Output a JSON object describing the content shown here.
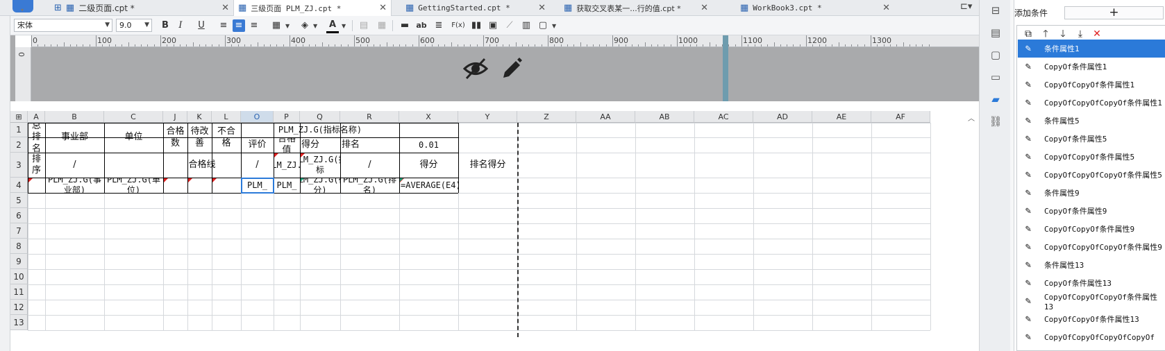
{
  "tabs": [
    {
      "label": "二级页面.cpt *",
      "active": false
    },
    {
      "label": "三级页面  PLM_ZJ.cpt *",
      "active": true
    },
    {
      "label": "GettingStarted.cpt *",
      "active": false
    },
    {
      "label": "获取交叉表某一...行的值.cpt *",
      "active": false
    },
    {
      "label": "WorkBook3.cpt *",
      "active": false
    }
  ],
  "toolbar": {
    "font_name": "宋体",
    "font_size": "9.0",
    "bold": "B",
    "italic": "I",
    "underline": "U",
    "text_glyph": "ab",
    "formula_glyph": "F(x)"
  },
  "ruler": [
    "0",
    "100",
    "200",
    "300",
    "400",
    "500",
    "600",
    "700",
    "800",
    "900",
    "1000",
    "1100",
    "1200",
    "1300"
  ],
  "vruler_zero": "0",
  "columns": [
    "A",
    "B",
    "C",
    "J",
    "K",
    "L",
    "O",
    "P",
    "Q",
    "R",
    "X",
    "Y",
    "Z",
    "AA",
    "AB",
    "AC",
    "AD",
    "AE",
    "AF"
  ],
  "rows": [
    "1",
    "2",
    "3",
    "4",
    "5",
    "6",
    "7",
    "8",
    "9",
    "10",
    "11",
    "12",
    "13"
  ],
  "cells": {
    "a12": "总排名",
    "b12": "事业部",
    "c12": "单位",
    "j12": "合格数",
    "k12": "待改善",
    "l12": "不合格",
    "o1r1": "PLM_ZJ.G(指标名称)",
    "o2": "评价",
    "p2": "合格值",
    "q2": "得分",
    "r2": "排名",
    "x2": "0.01",
    "a3": "排序",
    "b3": "/",
    "jl3": "合格线",
    "o3": "/",
    "p3": "PLM_ZJ.G",
    "q3": "PLM_ZJ.G(指标",
    "r3": "/",
    "x3": "得分",
    "y3": "排名得分",
    "b4": "PLM_ZJ.G(事业部)",
    "c4": "PLM_ZJ.G(单位)",
    "o4": "PLM_",
    "p4": "PLM_",
    "q4": "PLM_ZJ.G(得分)",
    "r4": "PLM_ZJ.G(排名)",
    "x4": "=AVERAGE(E4)"
  },
  "panel": {
    "add_label": "添加条件",
    "add_button": "+",
    "conditions": [
      "条件属性1",
      "CopyOf条件属性1",
      "CopyOfCopyOf条件属性1",
      "CopyOfCopyOfCopyOf条件属性1",
      "条件属性5",
      "CopyOf条件属性5",
      "CopyOfCopyOf条件属性5",
      "CopyOfCopyOfCopyOf条件属性5",
      "条件属性9",
      "CopyOf条件属性9",
      "CopyOfCopyOf条件属性9",
      "CopyOfCopyOfCopyOf条件属性9",
      "条件属性13",
      "CopyOf条件属性13",
      "CopyOfCopyOfCopyOf条件属性13",
      "CopyOfCopyOf条件属性13",
      "CopyOfCopyOfCopyOfCopyOf"
    ],
    "selected_index": 0
  },
  "icons": {
    "hide": "eye-off-icon",
    "edit": "pencil-icon"
  },
  "colors": {
    "accent": "#2b7ad9",
    "header_area": "#a9aaac",
    "flag": "#e02020"
  }
}
